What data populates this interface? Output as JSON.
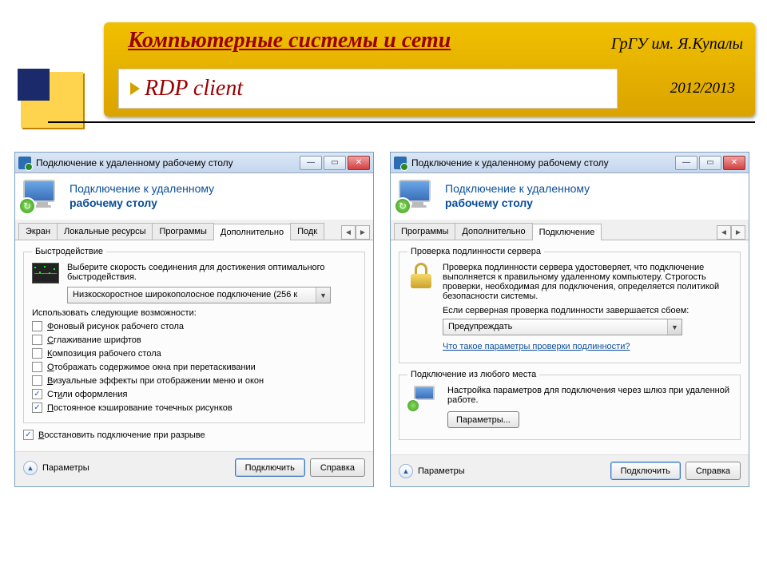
{
  "header": {
    "course": "Компьютерные системы и сети",
    "topic": "RDP client",
    "university": "ГрГУ им. Я.Купалы",
    "year": "2012/2013"
  },
  "win_title": "Подключение к удаленному рабочему столу",
  "banner_l1": "Подключение к удаленному",
  "banner_l2": "рабочему столу",
  "left": {
    "tabs": [
      "Экран",
      "Локальные ресурсы",
      "Программы",
      "Дополнительно",
      "Подк"
    ],
    "group_perf": "Быстродействие",
    "perf_hint": "Выберите скорость соединения для достижения оптимального быстродействия.",
    "combo_value": "Низкоскоростное широкополосное подключение (256 к",
    "use_following": "Использовать следующие возможности:",
    "opts": [
      {
        "label": "Фоновый рисунок рабочего стола",
        "checked": false,
        "ukey": "Ф"
      },
      {
        "label": "Сглаживание шрифтов",
        "checked": false,
        "ukey": "С"
      },
      {
        "label": "Композиция рабочего стола",
        "checked": false,
        "ukey": "К"
      },
      {
        "label": "Отображать содержимое окна при перетаскивании",
        "checked": false,
        "ukey": "О"
      },
      {
        "label": "Визуальные эффекты при отображении меню и окон",
        "checked": false,
        "ukey": "В"
      },
      {
        "label": "Стили оформления",
        "checked": true,
        "ukey": "и"
      },
      {
        "label": "Постоянное кэширование точечных рисунков",
        "checked": true,
        "ukey": "П"
      }
    ],
    "reconnect": "Восстановить подключение при разрыве"
  },
  "right": {
    "tabs": [
      "Программы",
      "Дополнительно",
      "Подключение"
    ],
    "group_auth": "Проверка подлинности сервера",
    "auth_para": "Проверка подлинности сервера удостоверяет, что подключение выполняется к правильному удаленному компьютеру. Строгость проверки, необходимая для подключения, определяется политикой безопасности системы.",
    "auth_fail": "Если серверная проверка подлинности завершается сбоем:",
    "combo_value": "Предупреждать",
    "auth_link": "Что такое параметры проверки подлинности?",
    "group_gw": "Подключение из любого места",
    "gw_para": "Настройка параметров для подключения через шлюз при удаленной работе.",
    "gw_btn": "Параметры..."
  },
  "footer": {
    "params": "Параметры",
    "connect": "Подключить",
    "help": "Справка"
  }
}
